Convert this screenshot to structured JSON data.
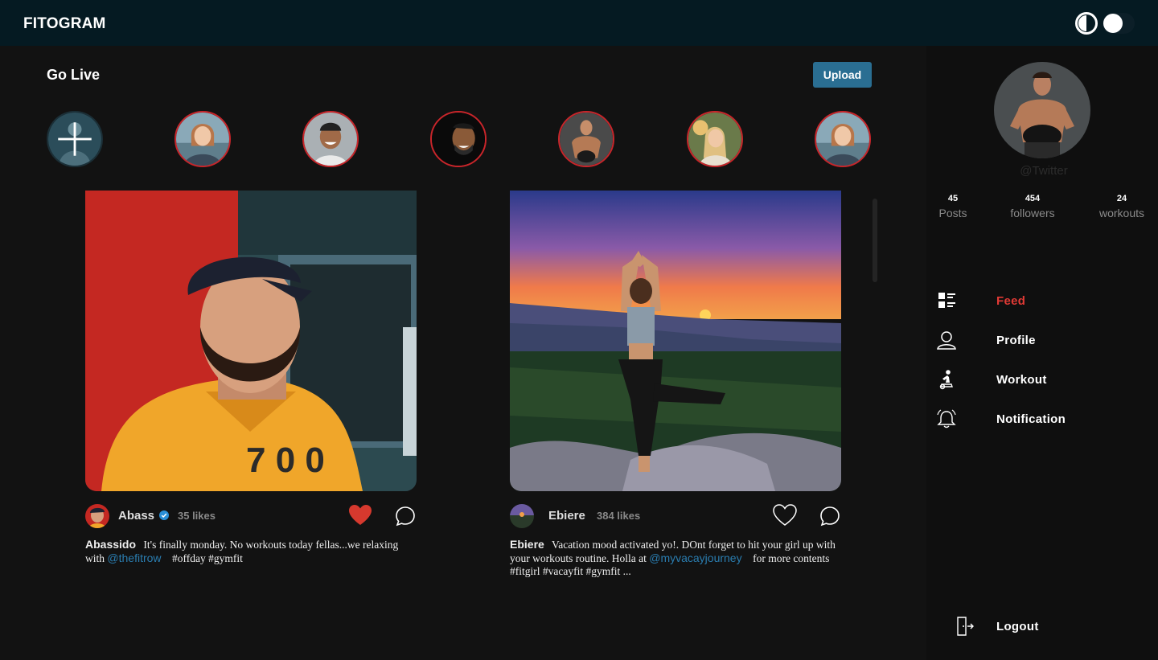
{
  "app": {
    "brand": "FITOGRAM"
  },
  "header": {
    "contrast_icon": "contrast-icon",
    "theme_toggle": "dark-mode-toggle"
  },
  "main": {
    "go_live_label": "Go Live",
    "upload_label": "Upload",
    "stories": [
      {
        "type": "add",
        "icon": "plus-icon"
      },
      {
        "type": "story"
      },
      {
        "type": "story"
      },
      {
        "type": "story"
      },
      {
        "type": "story"
      },
      {
        "type": "story"
      },
      {
        "type": "story"
      }
    ]
  },
  "posts": [
    {
      "author": "Abass",
      "verified": true,
      "likes": "35 likes",
      "liked": true,
      "caption_user": "Abassido",
      "caption_text": "It's finally monday. No workouts today fellas...we relaxing with",
      "mention": "@thefitrow",
      "caption_after": "#offday #gymfit"
    },
    {
      "author": "Ebiere",
      "verified": false,
      "likes": "384 likes",
      "liked": false,
      "caption_user": "Ebiere",
      "caption_text": "Vacation mood activated yo!. DOnt forget to hit your girl up with your workouts routine. Holla at",
      "mention": "@myvacayjourney",
      "caption_after": "for more contents #fitgirl #vacayfit #gymfit ..."
    }
  ],
  "sidebar": {
    "handle": "@Twitter",
    "stats": [
      {
        "value": "45",
        "label": "Posts"
      },
      {
        "value": "454",
        "label": "followers"
      },
      {
        "value": "24",
        "label": "workouts"
      }
    ],
    "nav": [
      {
        "label": "Feed",
        "icon": "feed-icon",
        "active": true
      },
      {
        "label": "Profile",
        "icon": "profile-icon",
        "active": false
      },
      {
        "label": "Workout",
        "icon": "workout-icon",
        "active": false
      },
      {
        "label": "Notification",
        "icon": "bell-icon",
        "active": false
      }
    ],
    "logout_label": "Logout"
  },
  "colors": {
    "topbar": "#051a22",
    "background": "#121212",
    "accent": "#2a6e92",
    "active": "#e23a35",
    "story_ring": "#c9252a",
    "mention": "#2a7db0"
  }
}
